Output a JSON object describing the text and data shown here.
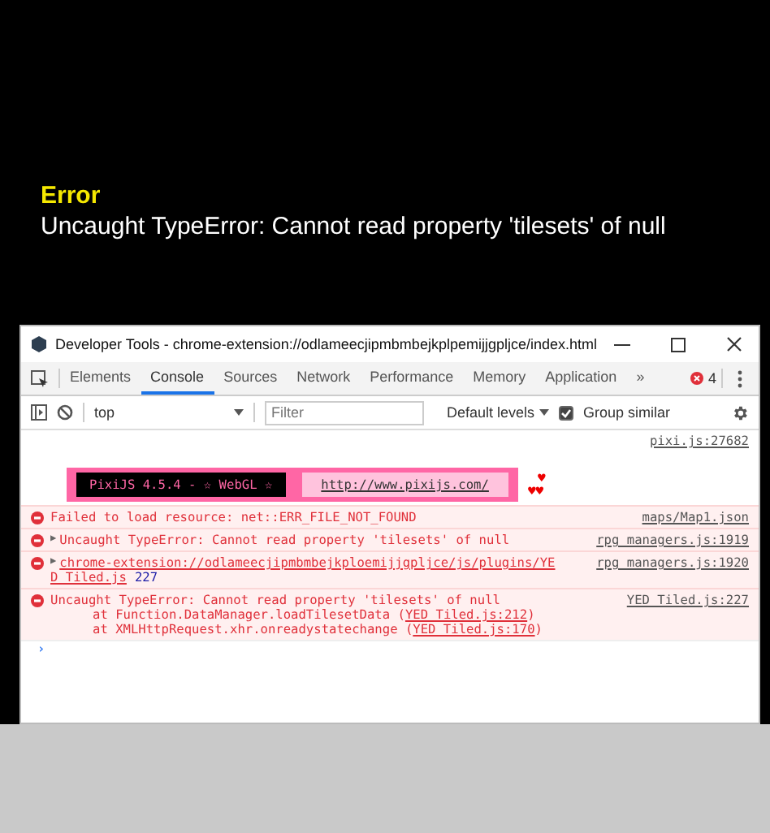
{
  "banner": {
    "title": "Error",
    "message": "Uncaught TypeError: Cannot read property 'tilesets' of null"
  },
  "devtools": {
    "title": "Developer Tools - chrome-extension://odlameecjipmbmbejkplpemijjgpljce/index.html",
    "tabs": [
      {
        "label": "Elements",
        "selected": false
      },
      {
        "label": "Console",
        "selected": true
      },
      {
        "label": "Sources",
        "selected": false
      },
      {
        "label": "Network",
        "selected": false
      },
      {
        "label": "Performance",
        "selected": false
      },
      {
        "label": "Memory",
        "selected": false
      },
      {
        "label": "Application",
        "selected": false
      }
    ],
    "more": "»",
    "error_count": "4",
    "toolbar": {
      "context": "top",
      "filter_placeholder": "Filter",
      "levels": "Default levels",
      "group_similar": {
        "label": "Group similar",
        "checked": true
      }
    },
    "messages": [
      {
        "kind": "log",
        "source": "pixi.js:27682"
      },
      {
        "kind": "pixi",
        "text": "PixiJS 4.5.4 - ☆ WebGL ☆",
        "link": "http://www.pixijs.com/",
        "heart_top": "♥",
        "hearts": "♥♥"
      },
      {
        "kind": "error",
        "text": "Failed to load resource: net::ERR_FILE_NOT_FOUND",
        "source": "maps/Map1.json"
      },
      {
        "kind": "error",
        "arrow": "▶",
        "text": "Uncaught TypeError: Cannot read property 'tilesets' of null",
        "source": "rpg_managers.js:1919"
      },
      {
        "kind": "error",
        "arrow": "▶",
        "link": "chrome-extension://odlameecjipmbmbejkploemijjgpljce/js/plugins/YE",
        "link_cont": "D_Tiled.js",
        "line": "227",
        "source": "rpg_managers.js:1920"
      },
      {
        "kind": "error",
        "text": "Uncaught TypeError: Cannot read property 'tilesets' of null",
        "source": "YED_Tiled.js:227",
        "stack": [
          {
            "text": "at Function.DataManager.loadTilesetData (",
            "link": "YED_Tiled.js:212",
            "after": ")"
          },
          {
            "text": "at XMLHttpRequest.xhr.onreadystatechange (",
            "link": "YED_Tiled.js:170",
            "after": ")"
          }
        ]
      }
    ],
    "prompt": "›"
  }
}
